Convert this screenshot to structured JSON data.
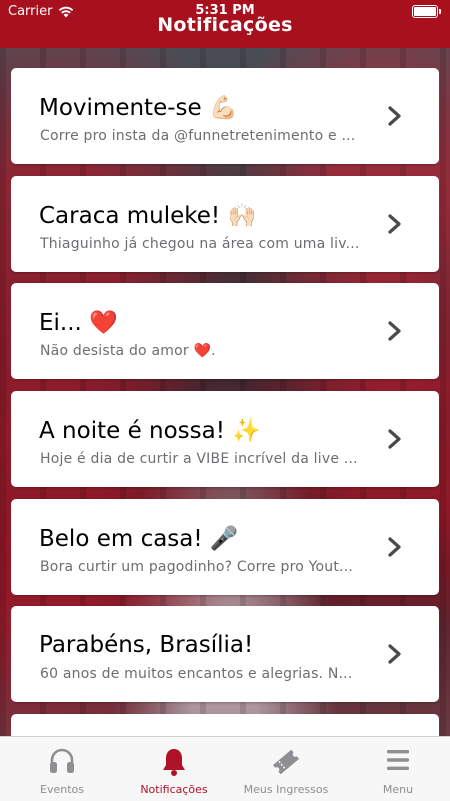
{
  "status_bar": {
    "carrier": "Carrier",
    "time": "5:31 PM"
  },
  "nav": {
    "title": "Notificações"
  },
  "notifications": [
    {
      "title": "Movimente-se 💪🏻",
      "subtitle": "Corre pro insta da @funnetretenimento e ..."
    },
    {
      "title": "Caraca muleke! 🙌🏻",
      "subtitle": "Thiaguinho já chegou na área com uma liv..."
    },
    {
      "title": "Ei... ❤️",
      "subtitle": "Não desista do amor ❤️."
    },
    {
      "title": "A noite é nossa! ✨",
      "subtitle": "Hoje é dia de curtir a VIBE incrível da live ..."
    },
    {
      "title": "Belo em casa! 🎤",
      "subtitle": "Bora curtir um pagodinho? Corre pro Yout..."
    },
    {
      "title": "Parabéns, Brasília!",
      "subtitle": "60 anos de muitos encantos e alegrias. N..."
    },
    {
      "title": "",
      "subtitle": ""
    }
  ],
  "tabs": [
    {
      "label": "Eventos",
      "icon": "headphones-icon"
    },
    {
      "label": "Notificações",
      "icon": "bell-icon",
      "active": true
    },
    {
      "label": "Meus Ingressos",
      "icon": "ticket-icon"
    },
    {
      "label": "Menu",
      "icon": "menu-icon"
    }
  ],
  "colors": {
    "accent": "#a8101e",
    "tab_active": "#b0122a",
    "tab_inactive": "#8e8e93"
  }
}
